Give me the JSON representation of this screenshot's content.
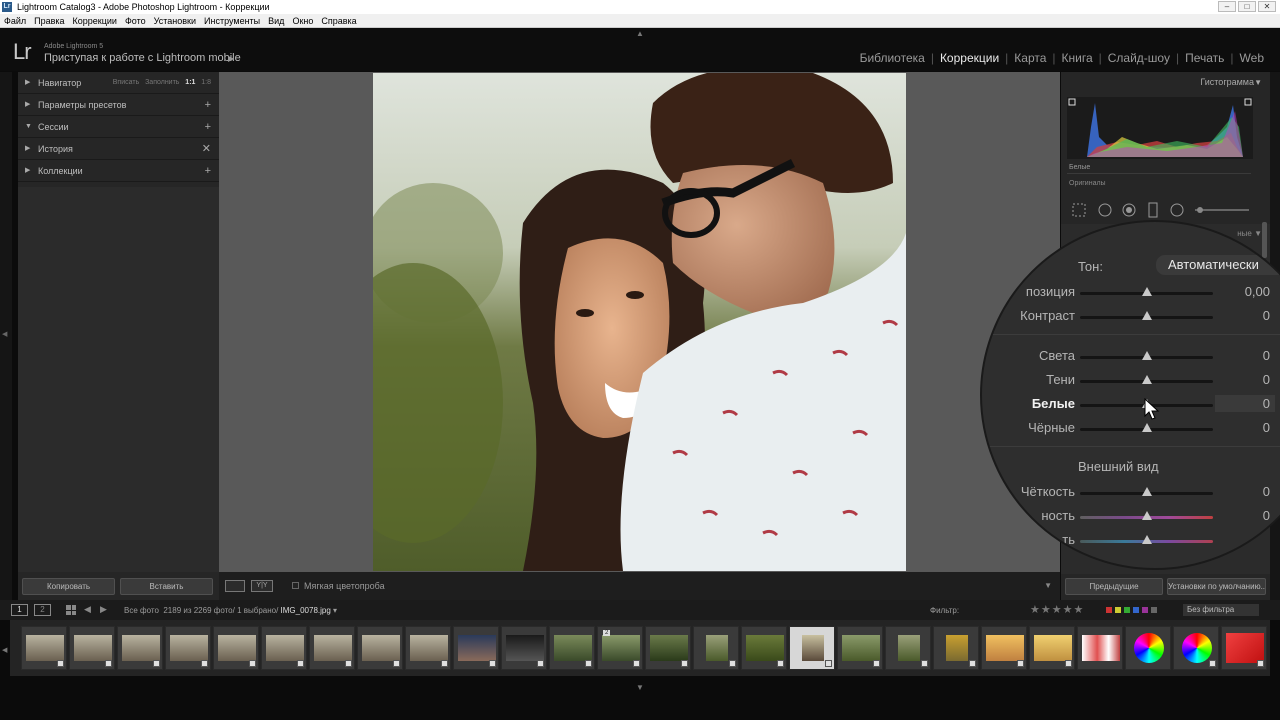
{
  "window": {
    "title": "Lightroom Catalog3 - Adobe Photoshop Lightroom - Коррекции",
    "app_icon": "Lr"
  },
  "menu": [
    "Файл",
    "Правка",
    "Коррекции",
    "Фото",
    "Установки",
    "Инструменты",
    "Вид",
    "Окно",
    "Справка"
  ],
  "identity": {
    "logo": "Lr",
    "small": "Adobe Lightroom 5",
    "big": "Приступая к работе с Lightroom mobile"
  },
  "modules": [
    {
      "label": "Библиотека",
      "active": false
    },
    {
      "label": "Коррекции",
      "active": true
    },
    {
      "label": "Карта",
      "active": false
    },
    {
      "label": "Книга",
      "active": false
    },
    {
      "label": "Слайд-шоу",
      "active": false
    },
    {
      "label": "Печать",
      "active": false
    },
    {
      "label": "Web",
      "active": false
    }
  ],
  "left_panel": {
    "navigator": "Навигатор",
    "nav_options": [
      "Вписать",
      "Заполнить",
      "1:1",
      "1:8"
    ],
    "presets": "Параметры пресетов",
    "sessions": "Сессии",
    "history": "История",
    "collections": "Коллекции",
    "copy": "Копировать",
    "paste": "Вставить"
  },
  "toolbar": {
    "soft_proof": "Мягкая цветопроба",
    "view_label": "Y|Y"
  },
  "right_panel": {
    "histogram": "Гистограмма",
    "whites_label": "Белые",
    "original": "Оригиналы",
    "basic_tail": "ные",
    "previous": "Предыдущие",
    "reset": "Установки по умолчанию..."
  },
  "lens": {
    "tone": "Тон:",
    "auto": "Автоматически",
    "appearance": "Внешний вид",
    "sliders": [
      {
        "label": "Экспозиция",
        "visible": "позиция",
        "value": "0,00"
      },
      {
        "label": "Контраст",
        "visible": "Контраст",
        "value": "0"
      },
      {
        "label": "Света",
        "visible": "Света",
        "value": "0"
      },
      {
        "label": "Тени",
        "visible": "Тени",
        "value": "0"
      },
      {
        "label": "Белые",
        "visible": "Белые",
        "value": "0"
      },
      {
        "label": "Чёрные",
        "visible": "Чёрные",
        "value": "0"
      },
      {
        "label": "Чёткость",
        "visible": "Чёткость",
        "value": "0"
      },
      {
        "label": "Красочность",
        "visible": "ность",
        "value": "0"
      },
      {
        "label": "Насыщенность",
        "visible": "ть",
        "value": "0"
      }
    ]
  },
  "filmbar": {
    "page1": "1",
    "page2": "2",
    "info_prefix": "Все фото",
    "info_count": "2189 из 2269 фото/ 1 выбрано/",
    "file": "IMG_0078.jpg",
    "filter_label": "Фильтр:",
    "filter_value": "Без фильтра"
  },
  "filmstrip_stack": "2",
  "colors": {
    "accent_label": "#eaeaea",
    "panel": "#262626",
    "center_bg": "#595959"
  }
}
